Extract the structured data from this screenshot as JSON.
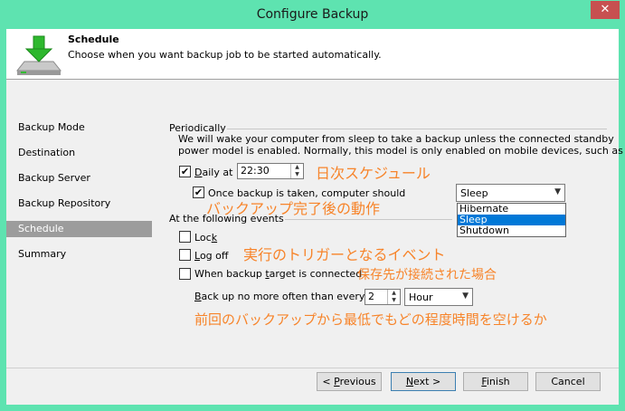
{
  "window": {
    "title": "Configure Backup",
    "close_glyph": "✕"
  },
  "header": {
    "title": "Schedule",
    "description": "Choose when you want backup job to be started automatically.",
    "icon": "download-drive-icon"
  },
  "nav": {
    "items": [
      {
        "label": "Backup Mode",
        "active": false
      },
      {
        "label": "Destination",
        "active": false
      },
      {
        "label": "Backup Server",
        "active": false
      },
      {
        "label": "Backup Repository",
        "active": false
      },
      {
        "label": "Schedule",
        "active": true
      },
      {
        "label": "Summary",
        "active": false
      }
    ]
  },
  "periodically": {
    "label": "Periodically",
    "info_line1": "We will wake your computer from sleep to take a backup unless the connected standby",
    "info_line2": "power model is enabled. Normally, this model is only enabled on mobile devices, such as",
    "daily": {
      "label_pre": "",
      "label_u": "D",
      "label_post": "aily at",
      "checked": true,
      "time": "22:30"
    },
    "once": {
      "label": "Once backup is taken, computer should",
      "checked": true
    },
    "after_action": {
      "selected": "Sleep",
      "options": [
        "Hibernate",
        "Sleep",
        "Shutdown"
      ]
    }
  },
  "events": {
    "label": "At the following events",
    "lock": {
      "label_pre": "Loc",
      "label_u": "k",
      "label_post": "",
      "checked": false
    },
    "logoff": {
      "label_pre": "",
      "label_u": "L",
      "label_post": "og off",
      "checked": false
    },
    "target": {
      "label_pre": "When backup ",
      "label_u": "t",
      "label_post": "arget is connected",
      "checked": false
    },
    "backup_often": {
      "label_pre": "",
      "label_u": "B",
      "label_post": "ack up no more often than every",
      "value": "2",
      "unit": "Hour"
    }
  },
  "annotations": {
    "daily": "日次スケジュール",
    "after": "バックアップ完了後の動作",
    "events": "実行のトリガーとなるイベント",
    "target": "保存先が接続された場合",
    "interval": "前回のバックアップから最低でもどの程度時間を空けるか"
  },
  "footer": {
    "previous": {
      "pre": "< ",
      "u": "P",
      "post": "revious"
    },
    "next": {
      "pre": "",
      "u": "N",
      "post": "ext >"
    },
    "finish": {
      "pre": "",
      "u": "F",
      "post": "inish"
    },
    "cancel": "Cancel"
  },
  "colors": {
    "frame": "#5ee3b0",
    "annotation": "#f7842a",
    "selection": "#0078d7",
    "close": "#c75050"
  }
}
